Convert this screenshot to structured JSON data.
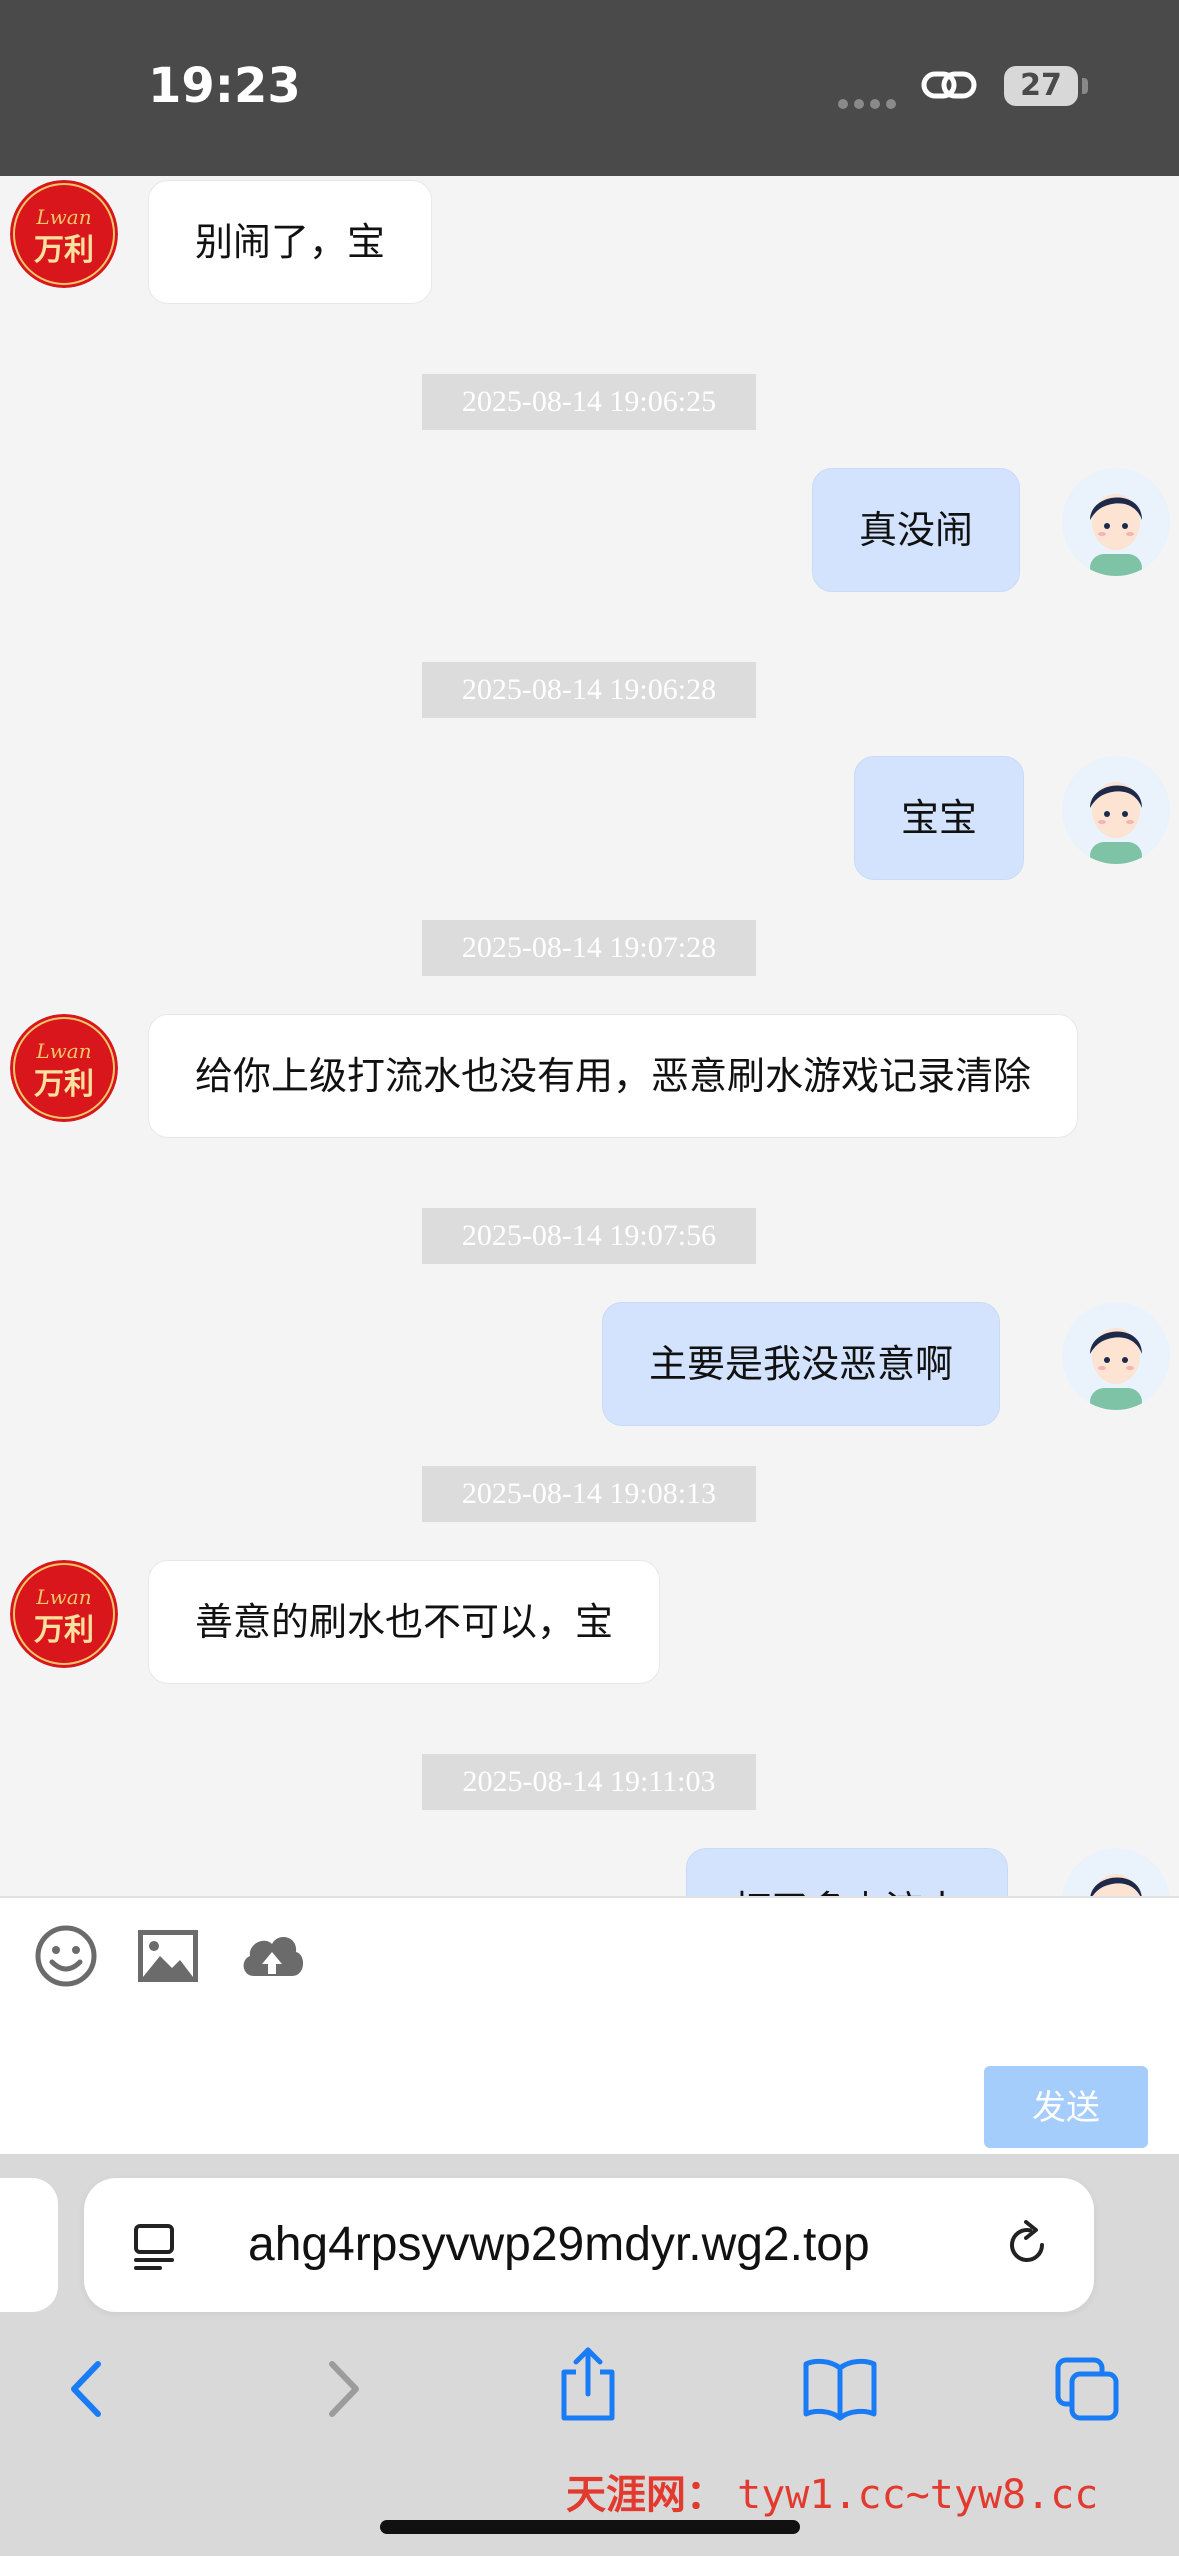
{
  "status_bar": {
    "time": "19:23",
    "battery": "27"
  },
  "agent": {
    "logo_text_script": "Lwan",
    "logo_text": "万利"
  },
  "messages": [
    {
      "from": "agent",
      "text": "别闹了，宝"
    },
    {
      "timestamp": "2025-08-14 19:06:25",
      "from": "user",
      "text": "真没闹"
    },
    {
      "timestamp": "2025-08-14 19:06:28",
      "from": "user",
      "text": "宝宝"
    },
    {
      "timestamp": "2025-08-14 19:07:28",
      "from": "agent",
      "text": "给你上级打流水也没有用，恶意刷水游戏记录清除"
    },
    {
      "timestamp": "2025-08-14 19:07:56",
      "from": "user",
      "text": "主要是我没恶意啊"
    },
    {
      "timestamp": "2025-08-14 19:08:13",
      "from": "agent",
      "text": "善意的刷水也不可以，宝"
    },
    {
      "timestamp": "2025-08-14 19:11:03",
      "from": "user",
      "text": "打了多少流水"
    }
  ],
  "input": {
    "send_label": "发送"
  },
  "browser": {
    "url": "ahg4rpsyvwp29mdyr.wg2.top"
  },
  "watermark": {
    "name": "天涯网：",
    "domains": "tyw1.cc~tyw8.cc"
  },
  "colors": {
    "accent": "#a4cdfb",
    "user_bubble": "#d3e3fe",
    "agent_logo": "#d8161b"
  }
}
